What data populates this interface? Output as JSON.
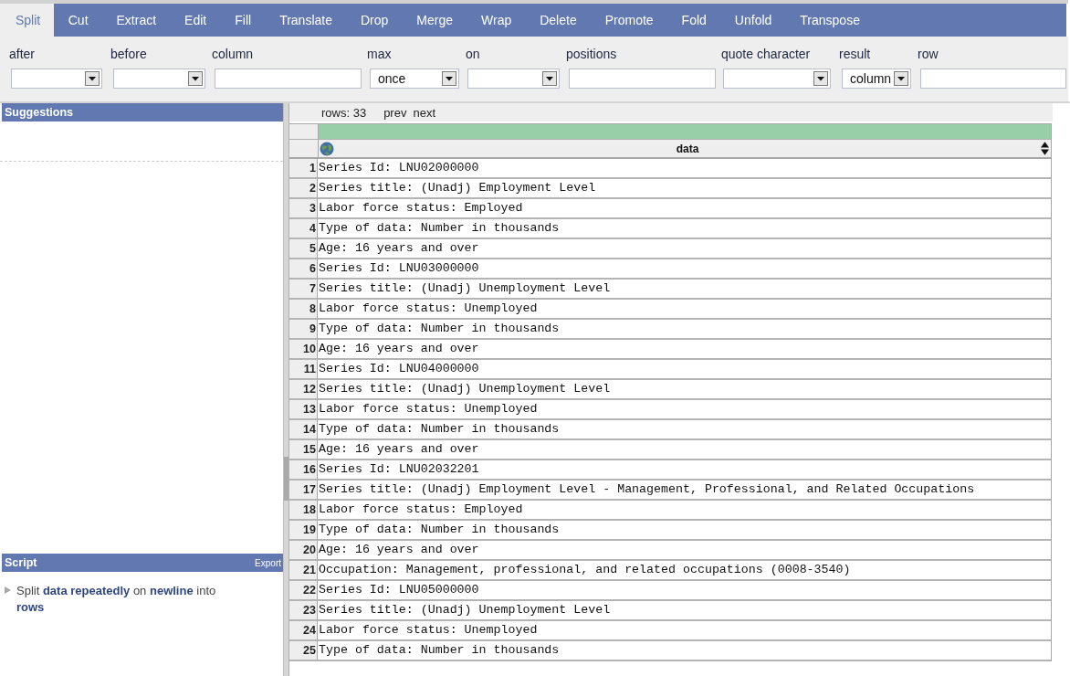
{
  "tabs": [
    {
      "label": "Split",
      "selected": true
    },
    {
      "label": "Cut",
      "selected": false
    },
    {
      "label": "Extract",
      "selected": false
    },
    {
      "label": "Edit",
      "selected": false
    },
    {
      "label": "Fill",
      "selected": false
    },
    {
      "label": "Translate",
      "selected": false
    },
    {
      "label": "Drop",
      "selected": false
    },
    {
      "label": "Merge",
      "selected": false
    },
    {
      "label": "Wrap",
      "selected": false
    },
    {
      "label": "Delete",
      "selected": false
    },
    {
      "label": "Promote",
      "selected": false
    },
    {
      "label": "Fold",
      "selected": false
    },
    {
      "label": "Unfold",
      "selected": false
    },
    {
      "label": "Transpose",
      "selected": false
    }
  ],
  "form_fields": [
    {
      "label": "after",
      "kind": "select"
    },
    {
      "label": "before",
      "kind": "select"
    },
    {
      "label": "column",
      "kind": "text"
    },
    {
      "label": "max",
      "kind": "select",
      "value": "once"
    },
    {
      "label": "on",
      "kind": "select"
    },
    {
      "label": "positions",
      "kind": "text"
    },
    {
      "label": "quote character",
      "kind": "select"
    },
    {
      "label": "result",
      "kind": "select",
      "value": "column"
    },
    {
      "label": "row",
      "kind": "text"
    }
  ],
  "suggestions_panel": {
    "title": "Suggestions"
  },
  "script_panel": {
    "title": "Script",
    "export_link": "Export",
    "steps": [
      {
        "text": "Split **data repeatedly** on **newline** into **rows**"
      }
    ]
  },
  "table": {
    "row_count": "rows: 33",
    "prev_link": "prev",
    "next_link": "next",
    "columns": [
      {
        "name": "data",
        "level": 1
      }
    ],
    "rows": [
      {
        "number": "1",
        "cells": [
          "Series Id: LNU02000000"
        ]
      },
      {
        "number": "2",
        "cells": [
          "Series title: (Unadj) Employment Level"
        ]
      },
      {
        "number": "3",
        "cells": [
          "Labor force status: Employed"
        ]
      },
      {
        "number": "4",
        "cells": [
          "Type of data: Number in thousands"
        ]
      },
      {
        "number": "5",
        "cells": [
          "Age: 16 years and over"
        ]
      },
      {
        "number": "6",
        "cells": [
          "Series Id: LNU03000000"
        ]
      },
      {
        "number": "7",
        "cells": [
          "Series title: (Unadj) Unemployment Level"
        ]
      },
      {
        "number": "8",
        "cells": [
          "Labor force status: Unemployed"
        ]
      },
      {
        "number": "9",
        "cells": [
          "Type of data: Number in thousands"
        ]
      },
      {
        "number": "10",
        "cells": [
          "Age: 16 years and over"
        ]
      },
      {
        "number": "11",
        "cells": [
          "Series Id: LNU04000000"
        ]
      },
      {
        "number": "12",
        "cells": [
          "Series title: (Unadj) Unemployment Level"
        ]
      },
      {
        "number": "13",
        "cells": [
          "Labor force status: Unemployed"
        ]
      },
      {
        "number": "14",
        "cells": [
          "Type of data: Number in thousands"
        ]
      },
      {
        "number": "15",
        "cells": [
          "Age: 16 years and over"
        ]
      },
      {
        "number": "16",
        "cells": [
          "Series Id: LNU02032201"
        ]
      },
      {
        "number": "17",
        "cells": [
          "Series title: (Unadj) Employment Level - Management, Professional, and Related Occupations"
        ]
      },
      {
        "number": "18",
        "cells": [
          "Labor force status: Employed"
        ]
      },
      {
        "number": "19",
        "cells": [
          "Type of data: Number in thousands"
        ]
      },
      {
        "number": "20",
        "cells": [
          "Age: 16 years and over"
        ]
      },
      {
        "number": "21",
        "cells": [
          "Occupation: Management, professional, and related occupations (0008-3540)"
        ]
      },
      {
        "number": "22",
        "cells": [
          "Series Id: LNU05000000"
        ]
      },
      {
        "number": "23",
        "cells": [
          "Series title: (Unadj) Unemployment Level"
        ]
      },
      {
        "number": "24",
        "cells": [
          "Labor force status: Unemployed"
        ]
      },
      {
        "number": "25",
        "cells": [
          "Type of data: Number in thousands"
        ]
      }
    ]
  }
}
